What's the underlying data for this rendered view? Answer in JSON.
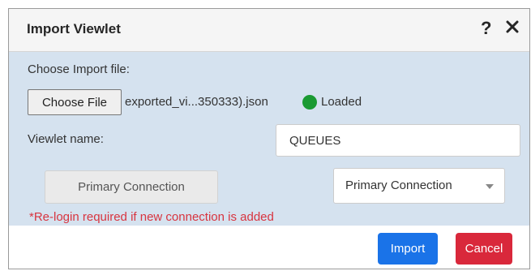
{
  "dialog": {
    "title": "Import Viewlet",
    "help_icon": "?",
    "close_icon": "close-icon"
  },
  "import_file": {
    "label": "Choose Import file:",
    "button_label": "Choose File",
    "file_name": "exported_vi...350333).json",
    "status": "Loaded",
    "status_color": "#1a9a32"
  },
  "viewlet_name": {
    "label": "Viewlet name:",
    "value": "QUEUES"
  },
  "connection": {
    "source": "Primary Connection",
    "target": "Primary Connection",
    "warning": "*Re-login required if new connection is added",
    "warning_color": "#d8343f"
  },
  "footer": {
    "import_label": "Import",
    "cancel_label": "Cancel",
    "import_color": "#1a73e8",
    "cancel_color": "#d9283b"
  }
}
